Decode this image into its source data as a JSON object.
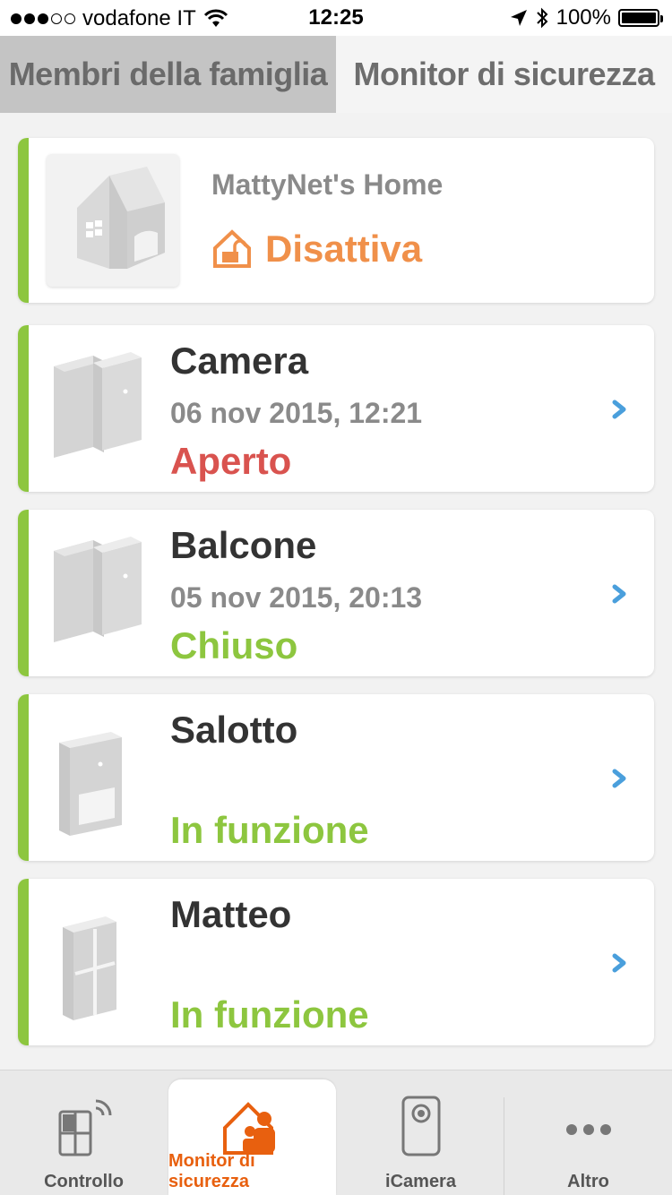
{
  "status_bar": {
    "carrier": "vodafone IT",
    "time": "12:25",
    "battery": "100%",
    "signal_dots_filled": 3,
    "signal_dots_total": 5
  },
  "top_tabs": {
    "family": "Membri della famiglia",
    "security": "Monitor di sicurezza",
    "active": "family"
  },
  "home": {
    "name": "MattyNet's Home",
    "status": "Disattiva"
  },
  "devices": [
    {
      "name": "Camera",
      "time": "06 nov 2015, 12:21",
      "state": "Aperto",
      "state_kind": "open",
      "icon": "door-window-sensor-icon"
    },
    {
      "name": "Balcone",
      "time": "05 nov 2015, 20:13",
      "state": "Chiuso",
      "state_kind": "ok",
      "icon": "door-window-sensor-icon"
    },
    {
      "name": "Salotto",
      "time": "",
      "state": "In funzione",
      "state_kind": "ok",
      "icon": "motion-sensor-icon"
    },
    {
      "name": "Matteo",
      "time": "",
      "state": "In funzione",
      "state_kind": "ok",
      "icon": "wall-switch-icon"
    }
  ],
  "tab_bar": {
    "control": "Controllo",
    "security": "Monitor di sicurezza",
    "icamera": "iCamera",
    "more": "Altro"
  },
  "colors": {
    "accent_green": "#8dc63f",
    "orange": "#f0904a",
    "red": "#d9534f",
    "tab_active": "#e8600f",
    "chevron": "#4a9fdc"
  }
}
